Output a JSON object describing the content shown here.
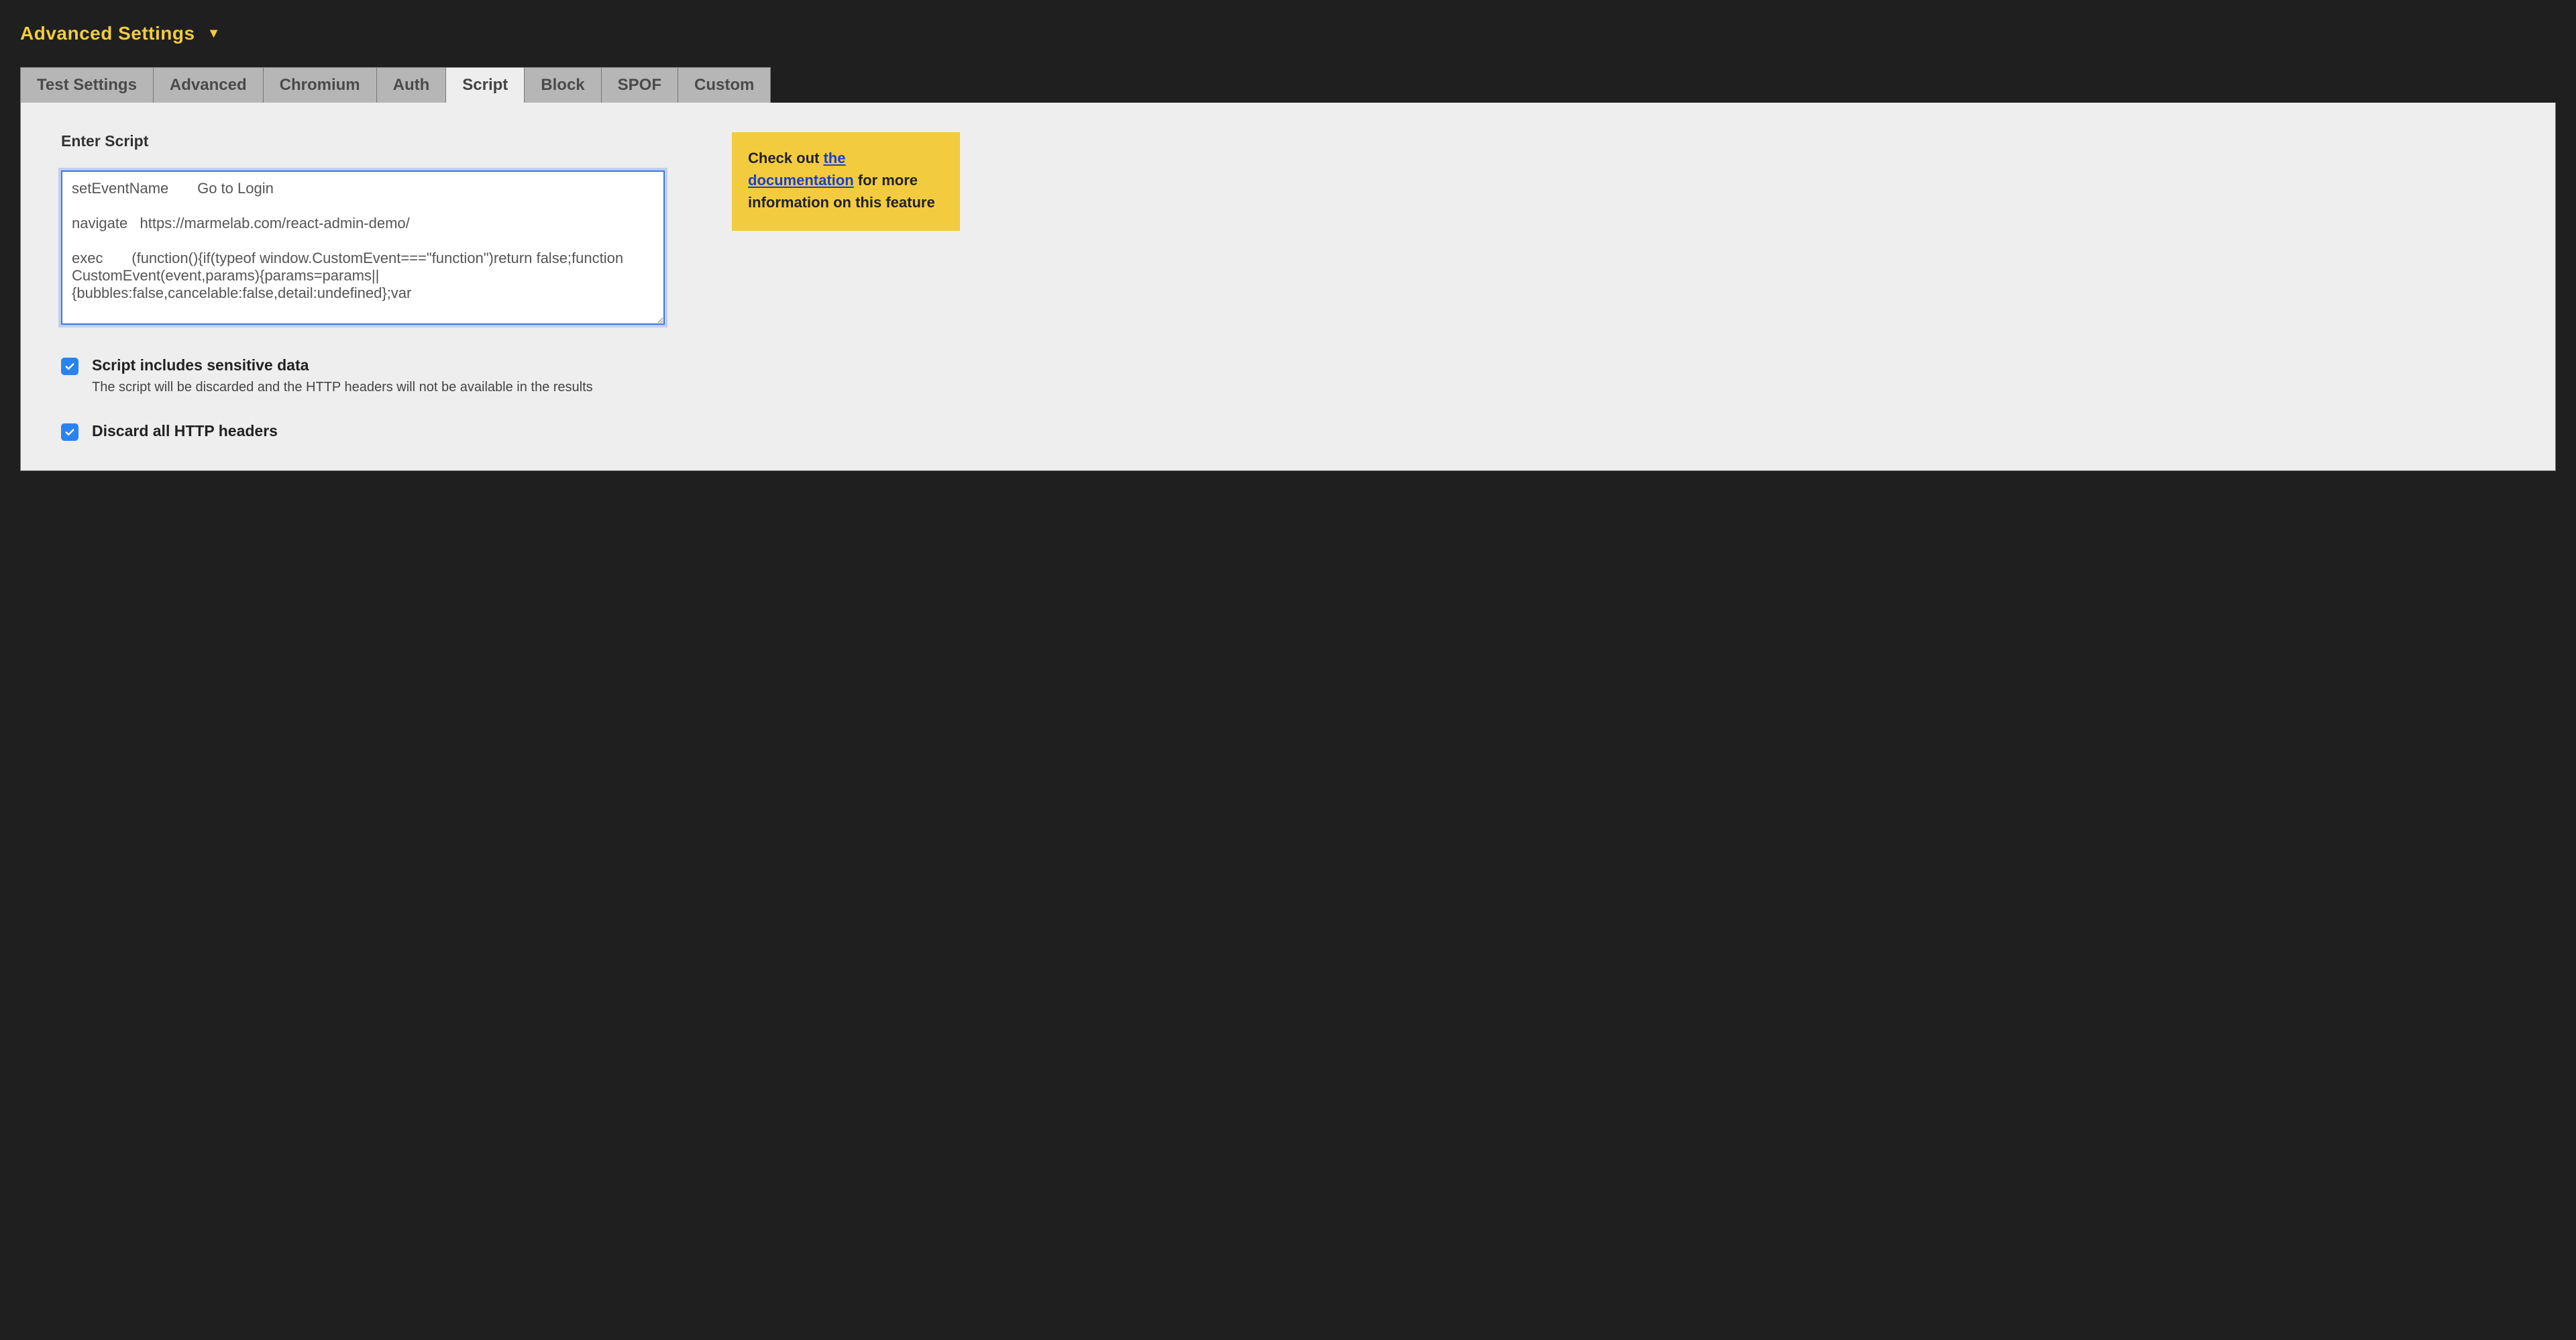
{
  "heading": "Advanced Settings",
  "tabs": [
    {
      "label": "Test Settings",
      "active": false
    },
    {
      "label": "Advanced",
      "active": false
    },
    {
      "label": "Chromium",
      "active": false
    },
    {
      "label": "Auth",
      "active": false
    },
    {
      "label": "Script",
      "active": true
    },
    {
      "label": "Block",
      "active": false
    },
    {
      "label": "SPOF",
      "active": false
    },
    {
      "label": "Custom",
      "active": false
    }
  ],
  "script_field": {
    "label": "Enter Script",
    "value": "setEventName       Go to Login\n\nnavigate   https://marmelab.com/react-admin-demo/\n\nexec       (function(){if(typeof window.CustomEvent===\"function\")return false;function CustomEvent(event,params){params=params||{bubbles:false,cancelable:false,detail:undefined};var"
  },
  "checkboxes": {
    "sensitive": {
      "label": "Script includes sensitive data",
      "sub": "The script will be discarded and the HTTP headers will not be available in the results",
      "checked": true
    },
    "discard_headers": {
      "label": "Discard all HTTP headers",
      "checked": true
    }
  },
  "callout": {
    "prefix": "Check out ",
    "link_text": "the documentation",
    "suffix": " for more information on this feature"
  }
}
